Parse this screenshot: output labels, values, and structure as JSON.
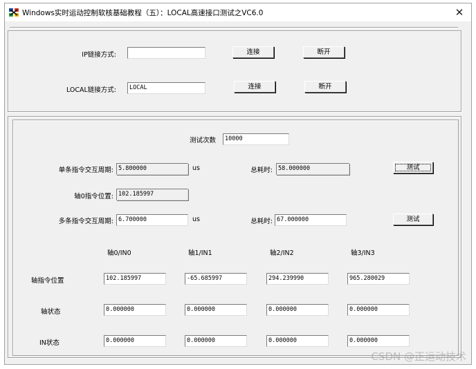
{
  "window": {
    "title": "Windows实时运动控制软核基础教程（五）：LOCAL高速接口测试之VC6.0",
    "close": "✕",
    "icon": "app-icon"
  },
  "connect": {
    "ip_label": "IP链接方式:",
    "ip_value": "",
    "ip_connect": "连接",
    "ip_disconnect": "断开",
    "local_label": "LOCAL链接方式:",
    "local_value": "LOCAL",
    "local_connect": "连接",
    "local_disconnect": "断开"
  },
  "test": {
    "count_label": "测试次数",
    "count_value": "10000",
    "single_label": "单条指令交互周期:",
    "single_value": "5.800000",
    "single_unit": "us",
    "single_total_label": "总耗时:",
    "single_total_value": "58.000000",
    "single_test": "测试",
    "axis0_pos_label": "轴0指令位置:",
    "axis0_pos_value": "102.185997",
    "multi_label": "多条指令交互周期:",
    "multi_value": "6.700000",
    "multi_unit": "us",
    "multi_total_label": "总耗时:",
    "multi_total_value": "67.000000",
    "multi_test": "测试"
  },
  "axes": {
    "headers": [
      "轴0/IN0",
      "轴1/IN1",
      "轴2/IN2",
      "轴3/IN3"
    ],
    "rows": [
      {
        "label": "轴指令位置",
        "values": [
          "102.185997",
          "-65.685997",
          "294.239990",
          "965.280029"
        ]
      },
      {
        "label": "轴状态",
        "values": [
          "0.000000",
          "0.000000",
          "0.000000",
          "0.000000"
        ]
      },
      {
        "label": "IN状态",
        "values": [
          "0.000000",
          "0.000000",
          "0.000000",
          "0.000000"
        ]
      }
    ]
  },
  "watermark": "CSDN @正运动技术"
}
